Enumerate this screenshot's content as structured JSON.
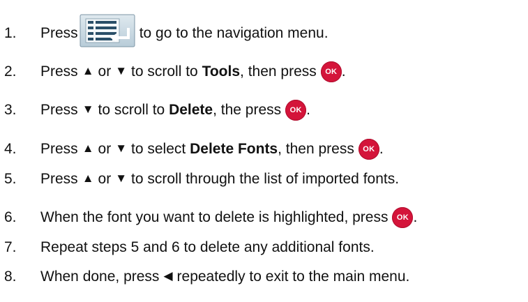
{
  "ok_label": "OK",
  "steps": [
    {
      "number": "1.",
      "before": "Press",
      "after": "to go to the navigation menu.",
      "icon": "navigation-menu-icon"
    },
    {
      "number": "2.",
      "t1": "Press",
      "up": "▲",
      "t2": "or",
      "down": "▼",
      "t3": "to scroll to",
      "bold": "Tools",
      "t4": ", then press",
      "end": "."
    },
    {
      "number": "3.",
      "t1": "Press",
      "down": "▼",
      "t2": "to scroll to",
      "bold": "Delete",
      "t3": ", the press",
      "end": "."
    },
    {
      "number": "4.",
      "t1": "Press",
      "up": "▲",
      "t2": "or",
      "down": "▼",
      "t3": "to select",
      "bold": "Delete Fonts",
      "t4": ", then press",
      "end": "."
    },
    {
      "number": "5.",
      "t1": "Press",
      "up": "▲",
      "t2": "or",
      "down": "▼",
      "t3": "to scroll through the list of imported fonts."
    },
    {
      "number": "6.",
      "t1": "When the font you want to delete is highlighted, press",
      "end": "."
    },
    {
      "number": "7.",
      "t1": "Repeat steps 5 and 6 to delete any additional fonts."
    },
    {
      "number": "8.",
      "t1": "When done, press",
      "left": "◀",
      "t2": "repeatedly to exit to the main menu."
    }
  ]
}
